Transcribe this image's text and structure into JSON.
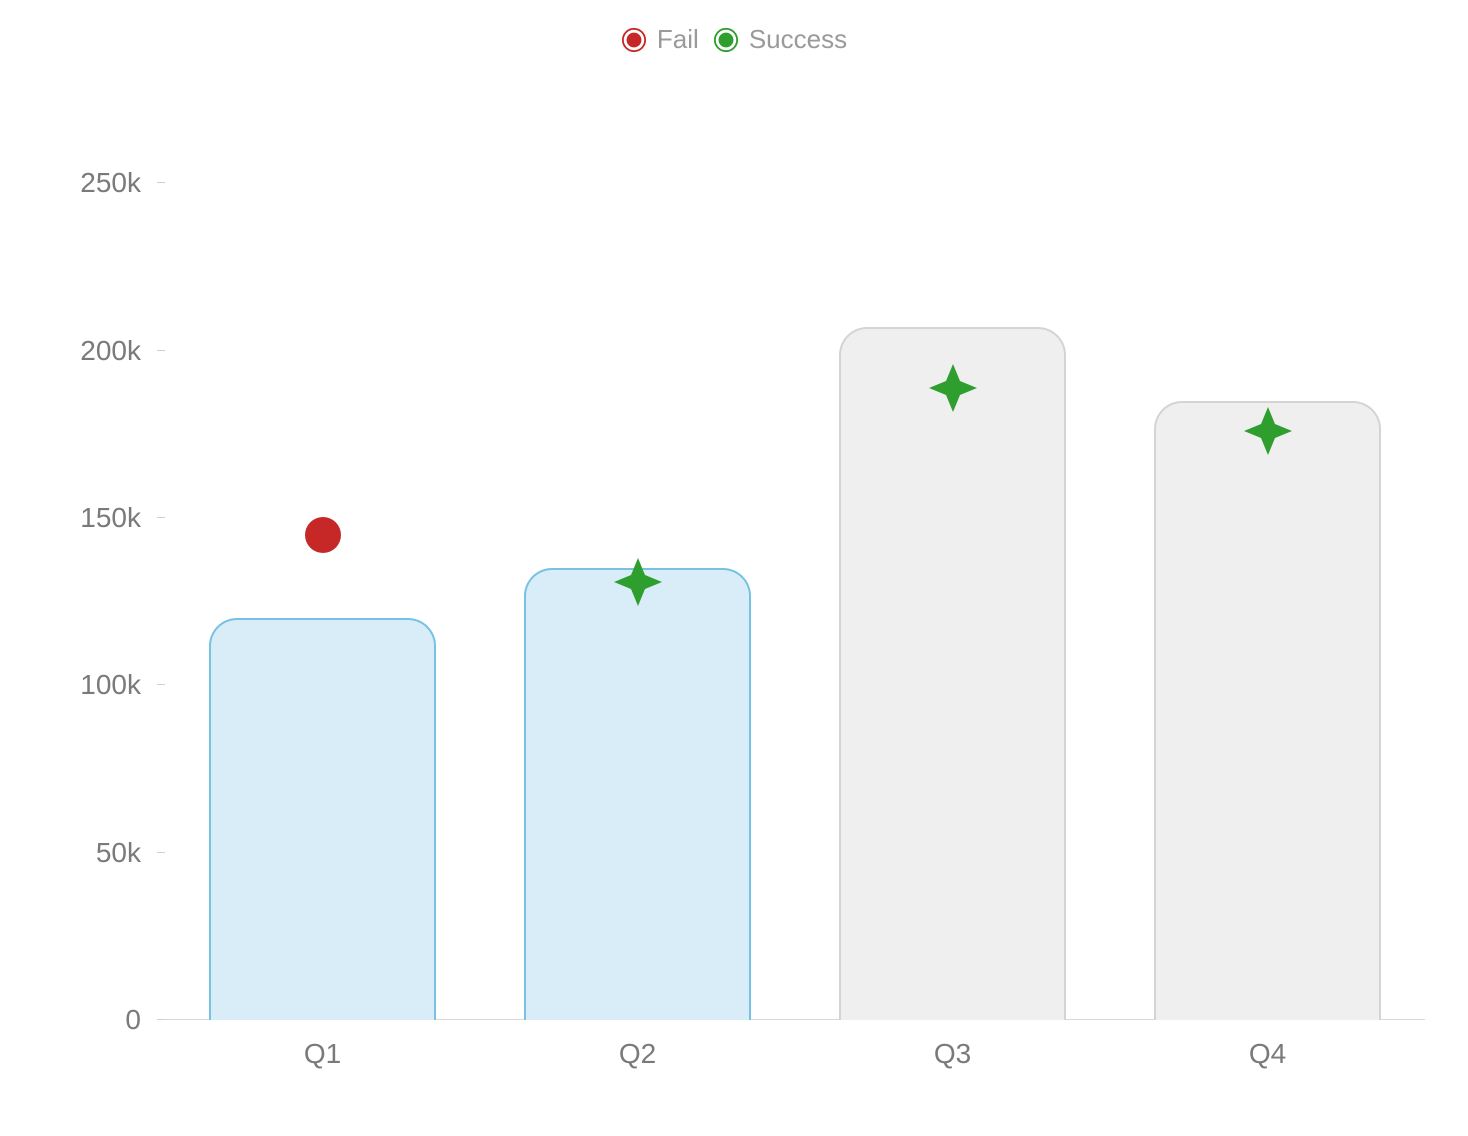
{
  "legend": {
    "items": [
      {
        "label": "Fail",
        "color": "#c62828",
        "shape": "circle"
      },
      {
        "label": "Success",
        "color": "#2e9e2e",
        "shape": "star4"
      }
    ]
  },
  "chart_data": {
    "type": "bar",
    "categories": [
      "Q1",
      "Q2",
      "Q3",
      "Q4"
    ],
    "series": [
      {
        "name": "Bar",
        "role": "bar",
        "values": [
          120000,
          135000,
          207000,
          185000
        ],
        "styles": [
          "past",
          "past",
          "future",
          "future"
        ]
      },
      {
        "name": "Target",
        "role": "marker",
        "values": [
          145000,
          131000,
          189000,
          176000
        ],
        "status": [
          "Fail",
          "Success",
          "Success",
          "Success"
        ]
      }
    ],
    "y_ticks": [
      0,
      50000,
      100000,
      150000,
      200000,
      250000
    ],
    "y_tick_labels": [
      "0",
      "50k",
      "100k",
      "150k",
      "200k",
      "250k"
    ],
    "ylim": [
      0,
      260000
    ],
    "xlabel": "",
    "ylabel": "",
    "title": ""
  },
  "colors": {
    "fail": "#c62828",
    "success": "#2e9e2e",
    "bar_past_fill": "#d8edf7",
    "bar_past_stroke": "#77c1e3",
    "bar_future_fill": "#efefef",
    "bar_future_stroke": "#d4d4d4"
  }
}
